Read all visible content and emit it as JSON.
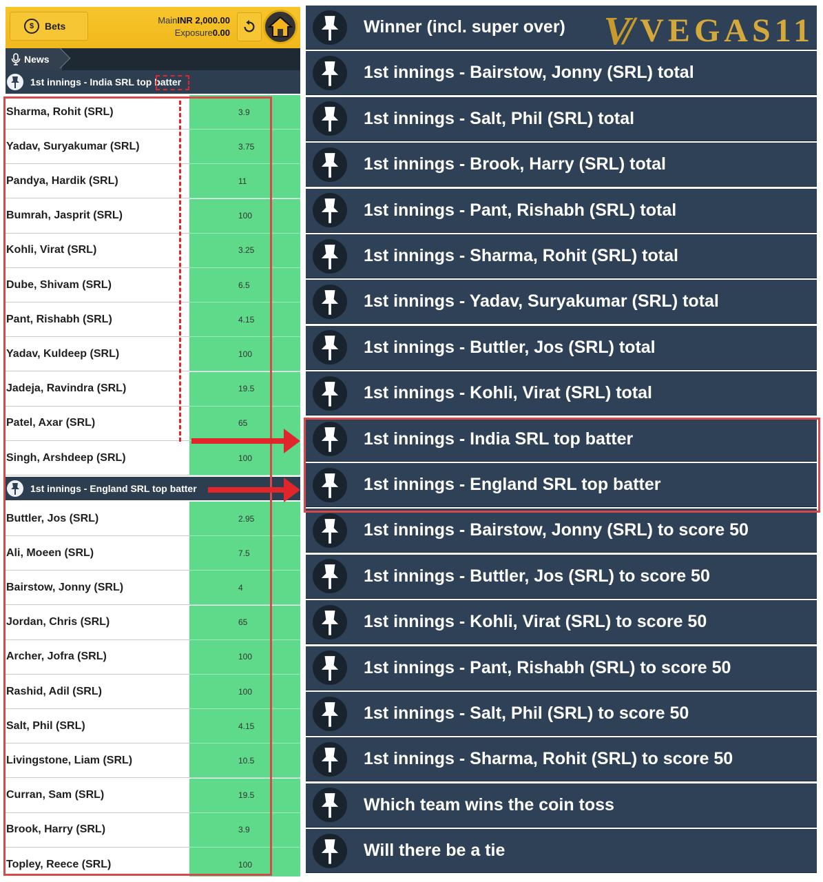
{
  "topbar": {
    "bets_label": "Bets",
    "main_label": "Main",
    "main_value": "INR 2,000.00",
    "exposure_label": "Exposure",
    "exposure_value": "0.00"
  },
  "news_label": "News",
  "markets": [
    {
      "title": "1st innings - India SRL top batter",
      "runners": [
        {
          "name": "Sharma, Rohit (SRL)",
          "odds": "3.9"
        },
        {
          "name": "Yadav, Suryakumar (SRL)",
          "odds": "3.75"
        },
        {
          "name": "Pandya, Hardik (SRL)",
          "odds": "11"
        },
        {
          "name": "Bumrah, Jasprit (SRL)",
          "odds": "100"
        },
        {
          "name": "Kohli, Virat (SRL)",
          "odds": "3.25"
        },
        {
          "name": "Dube, Shivam (SRL)",
          "odds": "6.5"
        },
        {
          "name": "Pant, Rishabh (SRL)",
          "odds": "4.15"
        },
        {
          "name": "Yadav, Kuldeep (SRL)",
          "odds": "100"
        },
        {
          "name": "Jadeja, Ravindra (SRL)",
          "odds": "19.5"
        },
        {
          "name": "Patel, Axar (SRL)",
          "odds": "65"
        },
        {
          "name": "Singh, Arshdeep (SRL)",
          "odds": "100"
        }
      ]
    },
    {
      "title": "1st innings - England SRL top batter",
      "runners": [
        {
          "name": "Buttler, Jos (SRL)",
          "odds": "2.95"
        },
        {
          "name": "Ali, Moeen (SRL)",
          "odds": "7.5"
        },
        {
          "name": "Bairstow, Jonny (SRL)",
          "odds": "4"
        },
        {
          "name": "Jordan, Chris (SRL)",
          "odds": "65"
        },
        {
          "name": "Archer, Jofra (SRL)",
          "odds": "100"
        },
        {
          "name": "Rashid, Adil (SRL)",
          "odds": "100"
        },
        {
          "name": "Salt, Phil (SRL)",
          "odds": "4.15"
        },
        {
          "name": "Livingstone, Liam (SRL)",
          "odds": "10.5"
        },
        {
          "name": "Curran, Sam (SRL)",
          "odds": "19.5"
        },
        {
          "name": "Brook, Harry (SRL)",
          "odds": "3.9"
        },
        {
          "name": "Topley, Reece (SRL)",
          "odds": "100"
        }
      ]
    }
  ],
  "logo_text": "VEGAS11",
  "logo_mark": "V/",
  "market_list": [
    "Winner (incl. super over)",
    "1st innings - Bairstow, Jonny (SRL) total",
    "1st innings - Salt, Phil (SRL) total",
    "1st innings - Brook, Harry (SRL) total",
    "1st innings - Pant, Rishabh (SRL) total",
    "1st innings - Sharma, Rohit (SRL) total",
    "1st innings - Yadav, Suryakumar (SRL) total",
    "1st innings - Buttler, Jos (SRL) total",
    "1st innings - Kohli, Virat (SRL) total",
    "1st innings - India SRL top batter",
    "1st innings - England SRL top batter",
    "1st innings - Bairstow, Jonny (SRL) to score 50",
    "1st innings - Buttler, Jos (SRL) to score 50",
    "1st innings - Kohli, Virat (SRL) to score 50",
    "1st innings - Pant, Rishabh (SRL) to score 50",
    "1st innings - Salt, Phil (SRL) to score 50",
    "1st innings - Sharma, Rohit (SRL) to score 50",
    "Which team wins the coin toss",
    "Will there be a tie"
  ],
  "colors": {
    "topbar": "#f7c52b",
    "odds_green": "#5fd98a",
    "market_bg": "#2e4157",
    "annotation_red": "#e0262b"
  }
}
